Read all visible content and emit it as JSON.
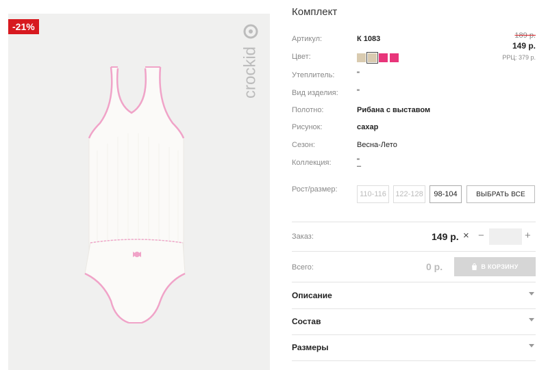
{
  "image_panel": {
    "discount_badge": "-21%",
    "brand_logo": "crockid"
  },
  "product": {
    "title": "Комплект",
    "fields": [
      {
        "label": "Артикул:",
        "value": "К 1083",
        "bold": true
      },
      {
        "label": "Цвет:",
        "value": ""
      },
      {
        "label": "Утеплитель:",
        "value": "\""
      },
      {
        "label": "Вид изделия:",
        "value": "\""
      },
      {
        "label": "Полотно:",
        "value": "Рибана с выставом",
        "bold": true
      },
      {
        "label": "Рисунок:",
        "value": "сахар",
        "bold": true
      },
      {
        "label": "Сезон:",
        "value": "Весна-Лето",
        "bold": false
      },
      {
        "label": "Коллекция:",
        "value": "\"",
        "value2": "–"
      }
    ],
    "swatch_colors": [
      "#d9cbb0",
      "#d9cbb0",
      "#e8357a",
      "#e8357a"
    ],
    "price_old": "189 р.",
    "price_new": "149 р.",
    "price_rrp": "РРЦ: 379 р."
  },
  "size": {
    "label": "Рост/размер:",
    "options": [
      {
        "label": "110-116",
        "available": false
      },
      {
        "label": "122-128",
        "available": false
      },
      {
        "label": "98-104",
        "available": true
      }
    ],
    "select_all_label": "ВЫБРАТЬ ВСЕ"
  },
  "order": {
    "label": "Заказ:",
    "price": "149 р.",
    "quantity": ""
  },
  "total": {
    "label": "Всего:",
    "value": "0 р.",
    "cart_button_label": "В КОРЗИНУ"
  },
  "accordions": [
    {
      "label": "Описание"
    },
    {
      "label": "Состав"
    },
    {
      "label": "Размеры"
    }
  ],
  "colors": {
    "discount": "#d7191f",
    "trim_pink": "#f0a3c8",
    "swatch_beige": "#d9cbb0",
    "swatch_pink": "#e8357a"
  }
}
